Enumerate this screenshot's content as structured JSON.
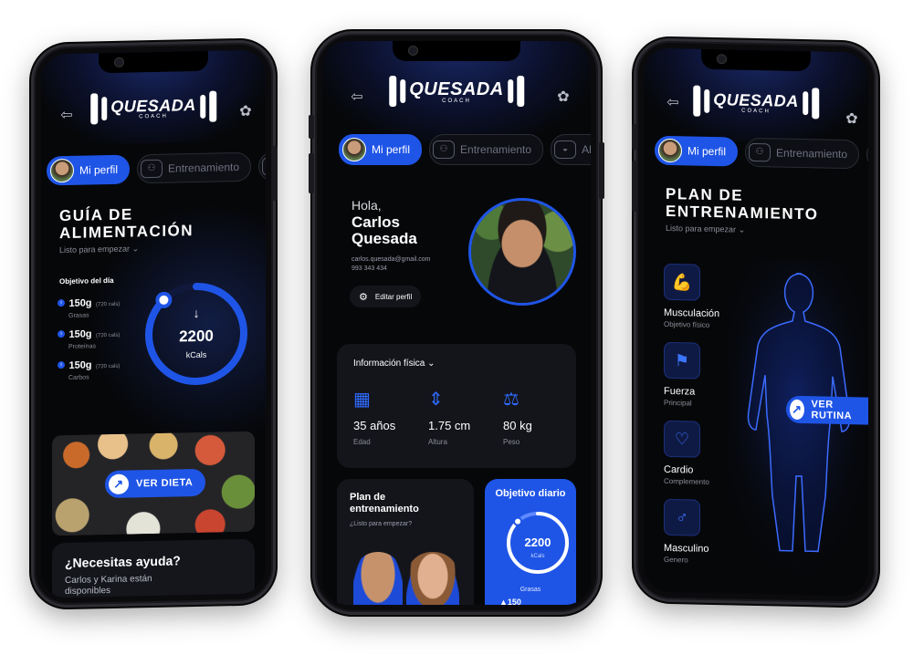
{
  "brand": {
    "name": "QUESADA",
    "tag": "COACH"
  },
  "tabs": {
    "profile": "Mi perfil",
    "training": "Entrenamiento",
    "diet_cut": "Ali"
  },
  "left": {
    "title_l1": "GUÍA DE",
    "title_l2": "ALIMENTACIÓN",
    "subtitle": "Listo para empezar",
    "objective_label": "Objetivo del día",
    "macros": [
      {
        "amount": "150g",
        "kcal": "(720 cals)",
        "name": "Grasas"
      },
      {
        "amount": "150g",
        "kcal": "(720 cals)",
        "name": "Proteínas"
      },
      {
        "amount": "150g",
        "kcal": "(720 cals)",
        "name": "Carbos"
      }
    ],
    "ring_value": "2200",
    "ring_unit": "kCals",
    "ring_progress": 0.88,
    "ver_dieta": "VER DIETA",
    "help_title": "¿Necesitas ayuda?",
    "help_text": "Carlos y Karina están disponibles"
  },
  "center": {
    "greeting": "Hola,",
    "first_name": "Carlos",
    "last_name": "Quesada",
    "email": "carlos.quesada@gmail.com",
    "phone": "993 343 434",
    "edit_profile": "Editar perfil",
    "info_title": "Información física",
    "stats": [
      {
        "value": "35 años",
        "label": "Edad",
        "icon": "calendar-icon"
      },
      {
        "value": "1.75 cm",
        "label": "Altura",
        "icon": "height-icon"
      },
      {
        "value": "80 kg",
        "label": "Peso",
        "icon": "weight-icon"
      }
    ],
    "plan_title_l1": "Plan de",
    "plan_title_l2": "entrenamiento",
    "plan_sub": "¿Listo para empezar?",
    "daily_title": "Objetivo diario",
    "daily_value": "2200",
    "daily_unit": "kCals",
    "daily_fat_label": "Grasas",
    "daily_cut": "▲150"
  },
  "right": {
    "title_l1": "PLAN DE",
    "title_l2": "ENTRENAMIENTO",
    "subtitle": "Listo para empezar",
    "ver_rutina": "VER RUTINA",
    "features": [
      {
        "label": "Musculación",
        "sub": "Objetivo físico",
        "icon": "muscle-icon"
      },
      {
        "label": "Fuerza",
        "sub": "Principal",
        "icon": "strength-icon"
      },
      {
        "label": "Cardio",
        "sub": "Complemento",
        "icon": "heart-icon"
      },
      {
        "label": "Masculino",
        "sub": "Genero",
        "icon": "male-icon"
      }
    ]
  },
  "colors": {
    "accent": "#1f55e6",
    "bg": "#060709",
    "card": "#14151b"
  }
}
